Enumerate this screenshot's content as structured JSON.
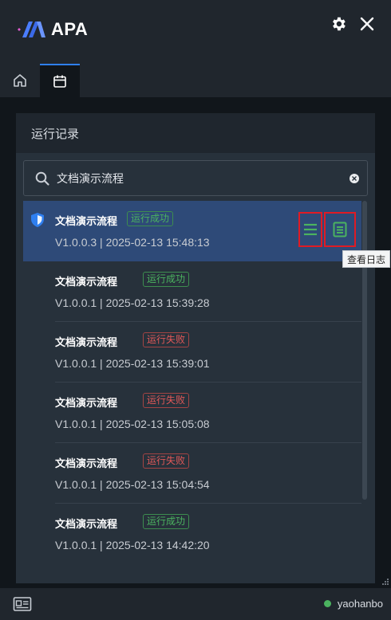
{
  "app": {
    "name": "APA"
  },
  "colors": {
    "accent": "#2f7ff0",
    "success": "#4bb35f",
    "failure": "#e15858",
    "selected_row": "#2e4a78",
    "highlight_border": "#e01b24"
  },
  "titlebar": {
    "settings_icon": "gear-icon",
    "close_icon": "close-icon"
  },
  "tabs": [
    {
      "icon": "home-icon",
      "active": false
    },
    {
      "icon": "calendar-icon",
      "active": true
    }
  ],
  "panel": {
    "title": "运行记录",
    "search": {
      "value": "文档演示流程",
      "placeholder": ""
    }
  },
  "records": [
    {
      "name": "文档演示流程",
      "status": "运行成功",
      "status_type": "success",
      "meta": "V1.0.0.3 | 2025-02-13 15:48:13",
      "selected": true
    },
    {
      "name": "文档演示流程",
      "status": "运行成功",
      "status_type": "success",
      "meta": "V1.0.0.1 | 2025-02-13 15:39:28",
      "selected": false
    },
    {
      "name": "文档演示流程",
      "status": "运行失败",
      "status_type": "fail",
      "meta": "V1.0.0.1 | 2025-02-13 15:39:01",
      "selected": false
    },
    {
      "name": "文档演示流程",
      "status": "运行失败",
      "status_type": "fail",
      "meta": "V1.0.0.1 | 2025-02-13 15:05:08",
      "selected": false
    },
    {
      "name": "文档演示流程",
      "status": "运行失败",
      "status_type": "fail",
      "meta": "V1.0.0.1 | 2025-02-13 15:04:54",
      "selected": false
    },
    {
      "name": "文档演示流程",
      "status": "运行成功",
      "status_type": "success",
      "meta": "V1.0.0.1 | 2025-02-13 14:42:20",
      "selected": false
    }
  ],
  "tooltip": {
    "text": "查看日志"
  },
  "footer": {
    "username": "yaohanbo",
    "status_color": "#4bb35f",
    "left_icon": "id-card-icon"
  }
}
